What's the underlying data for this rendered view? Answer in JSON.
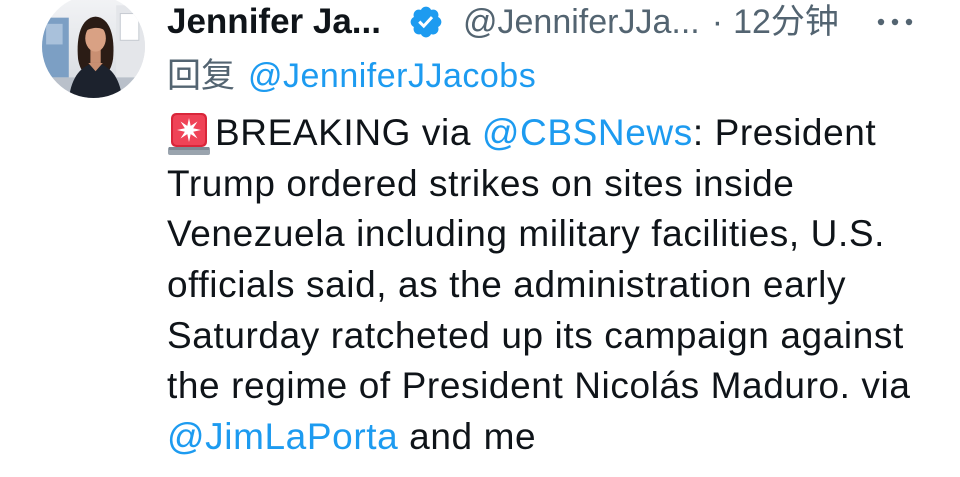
{
  "colors": {
    "background": "#ffffff",
    "text": "#0f1419",
    "muted": "#536471",
    "link": "#1d9bf0",
    "verified": "#1d9bf0"
  },
  "avatar": {
    "icon": "author-profile-photo"
  },
  "author": {
    "display_name": "Jennifer Ja...",
    "verified_icon": "verified-badge-icon",
    "handle": "@JenniferJJa...",
    "separator": "·",
    "time": "12分钟"
  },
  "more_options": {
    "icon": "more-options-icon"
  },
  "reply_context": {
    "label": "回复",
    "mention": "@JenniferJJacobs"
  },
  "tweet": {
    "leading_icon": "rotating-light-icon",
    "lines": [
      [
        {
          "text": "BREAKING via "
        },
        {
          "mention": "@CBSNews"
        },
        {
          "text": ": President"
        }
      ],
      [
        {
          "text": "Trump ordered strikes on sites inside"
        }
      ],
      [
        {
          "text": "Venezuela including military facilities, U.S."
        }
      ],
      [
        {
          "text": "officials said, as the administration early"
        }
      ],
      [
        {
          "text": "Saturday ratcheted up its campaign against"
        }
      ],
      [
        {
          "text": "the regime of President Nicolás Maduro. via"
        }
      ],
      [
        {
          "mention": "@JimLaPorta"
        },
        {
          "text": " and me"
        }
      ]
    ]
  }
}
